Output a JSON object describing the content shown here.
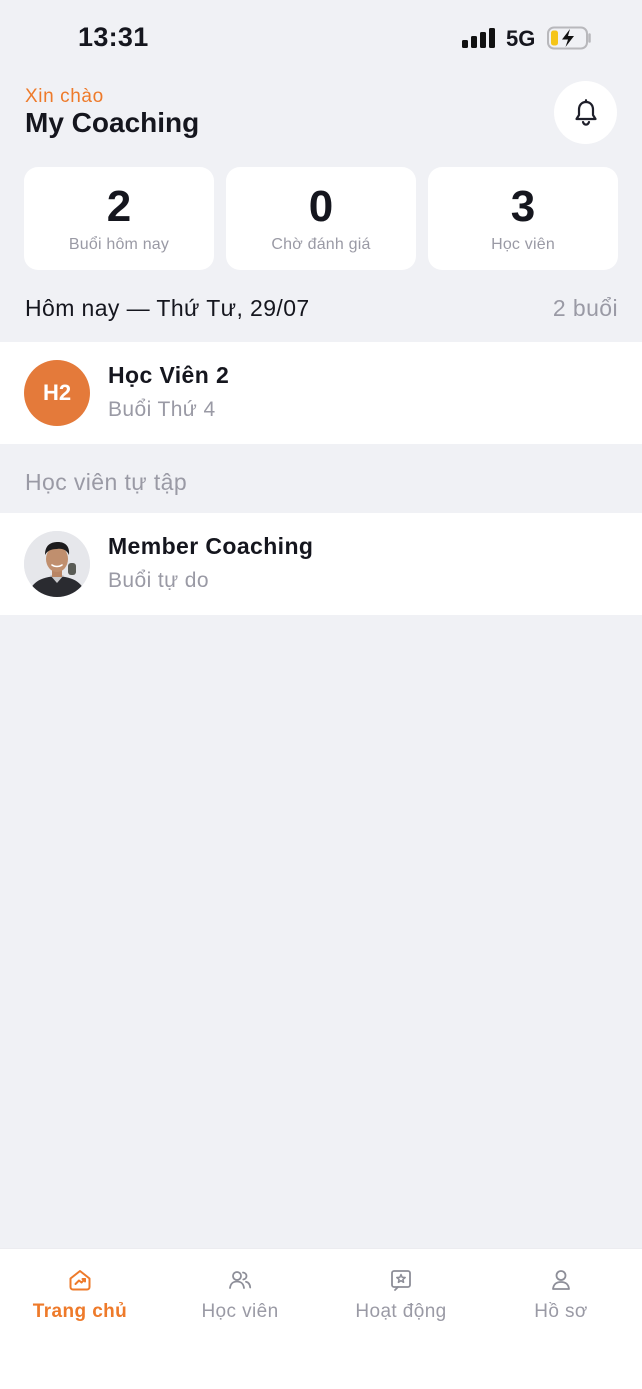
{
  "status_bar": {
    "time": "13:31",
    "network": "5G"
  },
  "header": {
    "greeting": "Xin chào",
    "title": "My Coaching"
  },
  "stats": [
    {
      "value": "2",
      "label": "Buổi hôm nay"
    },
    {
      "value": "0",
      "label": "Chờ đánh giá"
    },
    {
      "value": "3",
      "label": "Học viên"
    }
  ],
  "today": {
    "title": "Hôm nay — Thứ Tư, 29/07",
    "count": "2 buổi"
  },
  "sessions": [
    {
      "initials": "H2",
      "name": "Học Viên 2",
      "detail": "Buổi Thứ 4"
    }
  ],
  "self_training": {
    "title": "Học viên tự tập",
    "items": [
      {
        "name": "Member Coaching",
        "detail": "Buổi tự do"
      }
    ]
  },
  "tabs": [
    {
      "label": "Trang chủ",
      "icon": "home-icon",
      "active": true
    },
    {
      "label": "Học viên",
      "icon": "users-icon",
      "active": false
    },
    {
      "label": "Hoạt động",
      "icon": "activity-icon",
      "active": false
    },
    {
      "label": "Hồ sơ",
      "icon": "profile-icon",
      "active": false
    }
  ],
  "colors": {
    "accent": "#EE7A2A",
    "avatar_bg": "#E47A3A",
    "background": "#F0F1F5",
    "muted_text": "#9A9AA5"
  }
}
